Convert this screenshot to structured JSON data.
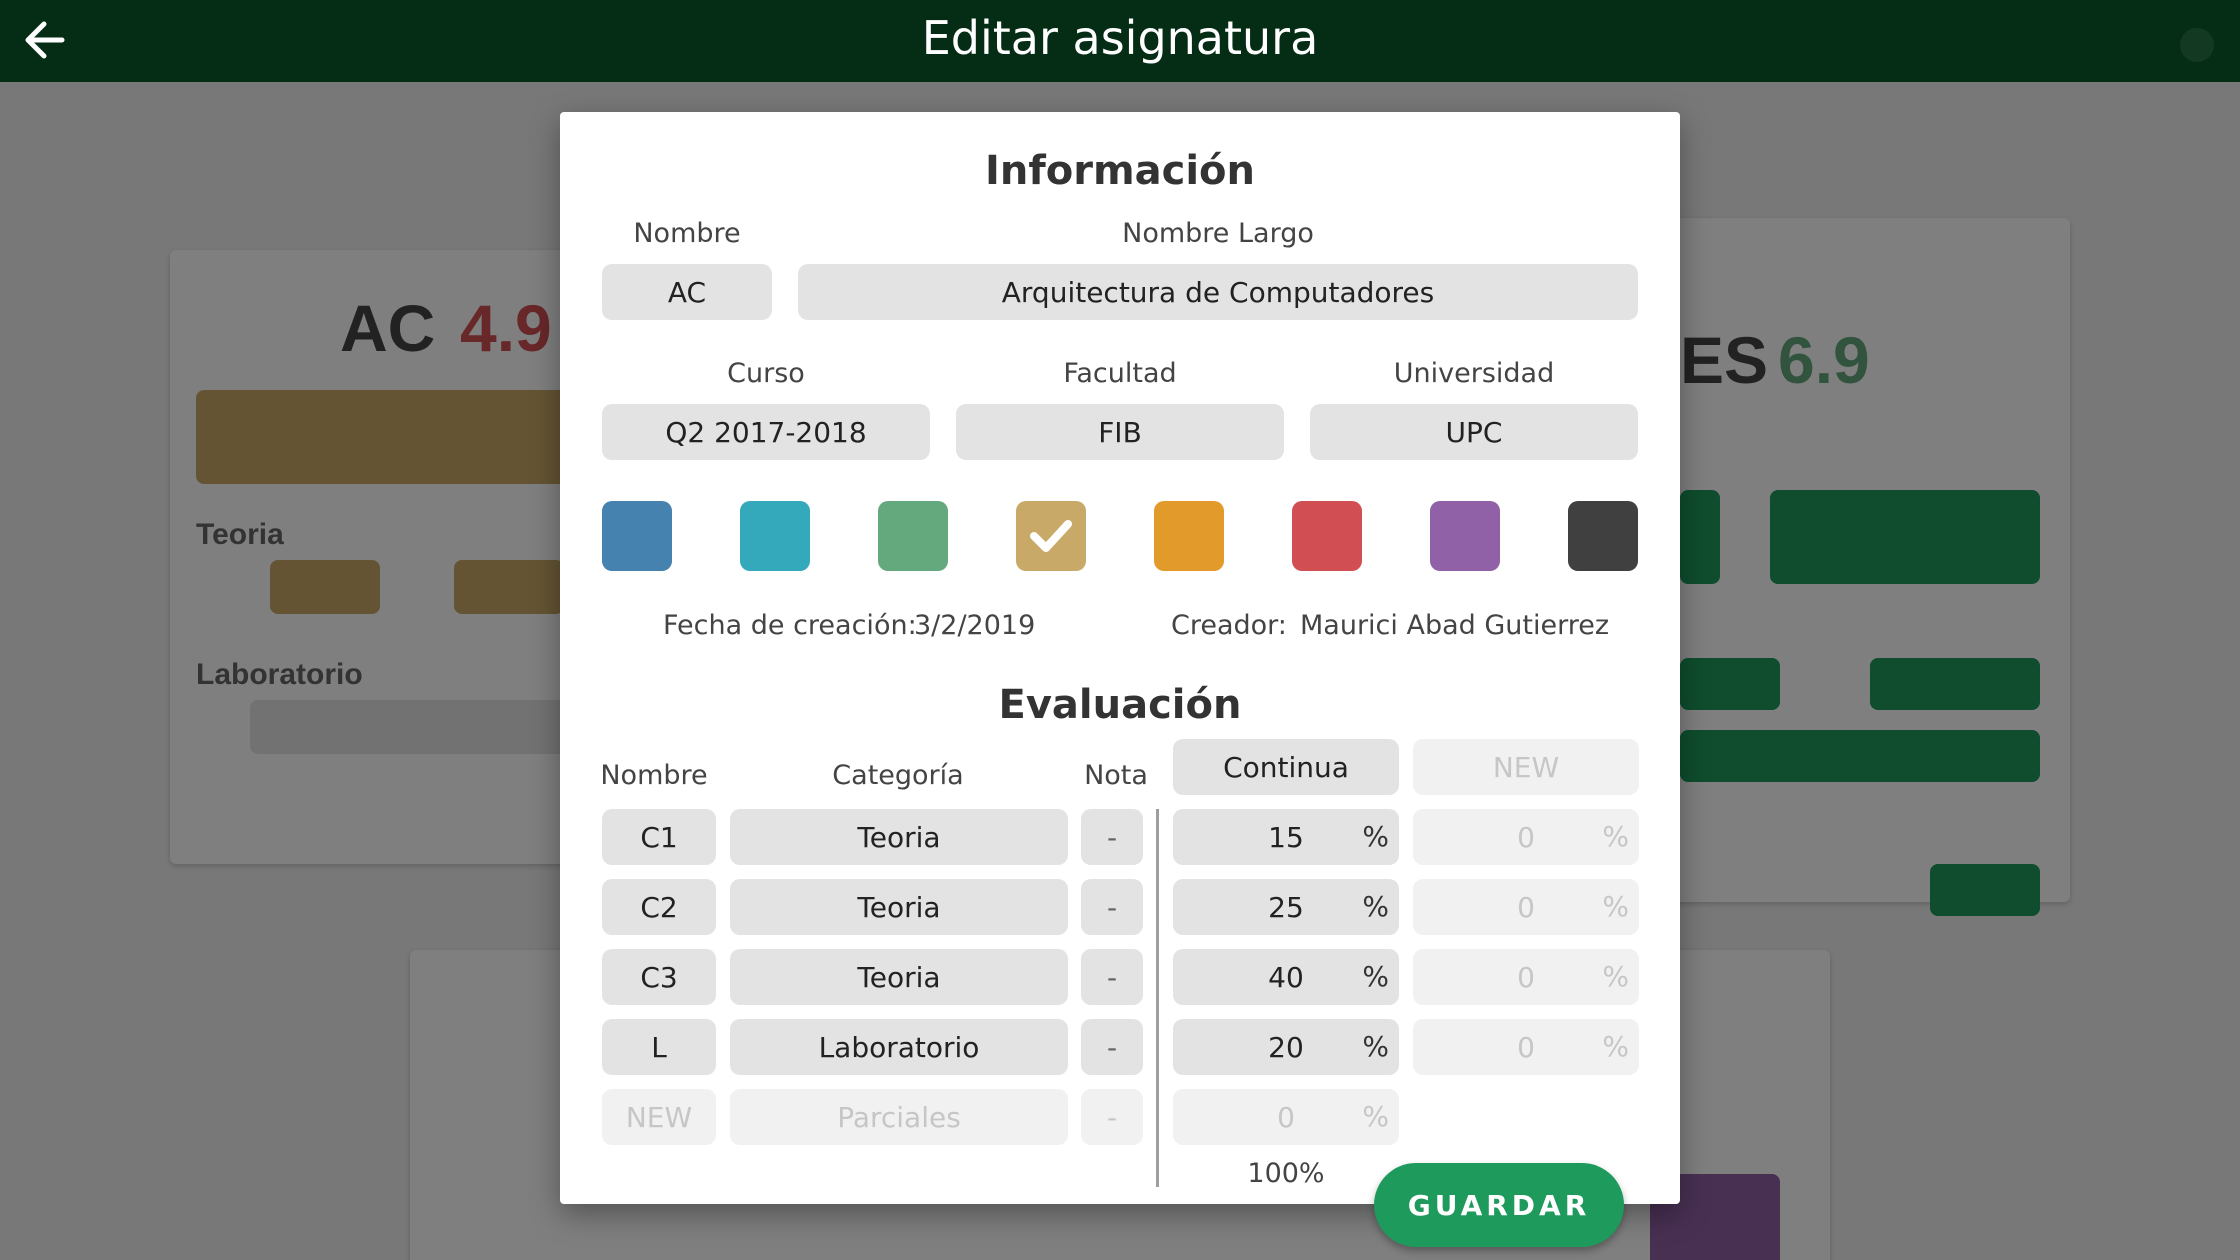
{
  "appbar": {
    "title": "Editar asignatura"
  },
  "background": {
    "card1_title": "AC",
    "card1_grade": "4.9",
    "card2_title": "ES",
    "card2_grade": "6.9",
    "card1_section1": "Teoria",
    "card1_section2": "Laboratorio"
  },
  "dialog": {
    "info_heading": "Información",
    "labels": {
      "nombre": "Nombre",
      "nombre_largo": "Nombre Largo",
      "curso": "Curso",
      "facultad": "Facultad",
      "universidad": "Universidad"
    },
    "fields": {
      "nombre": "AC",
      "nombre_largo": "Arquitectura de Computadores",
      "curso": "Q2 2017-2018",
      "facultad": "FIB",
      "universidad": "UPC"
    },
    "colors": [
      {
        "hex": "#4682b0",
        "selected": false
      },
      {
        "hex": "#33a9bb",
        "selected": false
      },
      {
        "hex": "#64a97d",
        "selected": false
      },
      {
        "hex": "#c8a967",
        "selected": true,
        "icon": "check-icon"
      },
      {
        "hex": "#e29b2b",
        "selected": false
      },
      {
        "hex": "#d14f53",
        "selected": false
      },
      {
        "hex": "#9161a7",
        "selected": false
      },
      {
        "hex": "#404040",
        "selected": false
      }
    ],
    "fecha_label": "Fecha de creación:",
    "fecha_value": "3/2/2019",
    "creador_label": "Creador:",
    "creador_value": "Maurici Abad Gutierrez",
    "eval_heading": "Evaluación",
    "eval_headers": {
      "nombre": "Nombre",
      "categoria": "Categoría",
      "nota": "Nota"
    },
    "modes": {
      "continua": "Continua",
      "new": "NEW"
    },
    "rows": [
      {
        "nombre": "C1",
        "categoria": "Teoria",
        "nota": "-",
        "continua": "15",
        "new": "0"
      },
      {
        "nombre": "C2",
        "categoria": "Teoria",
        "nota": "-",
        "continua": "25",
        "new": "0"
      },
      {
        "nombre": "C3",
        "categoria": "Teoria",
        "nota": "-",
        "continua": "40",
        "new": "0"
      },
      {
        "nombre": "L",
        "categoria": "Laboratorio",
        "nota": "-",
        "continua": "20",
        "new": "0"
      }
    ],
    "new_row": {
      "nombre": "NEW",
      "categoria": "Parciales",
      "nota": "-",
      "continua": "0"
    },
    "pct_symbol": "%",
    "total": "100%",
    "save_label": "GUARDAR"
  }
}
